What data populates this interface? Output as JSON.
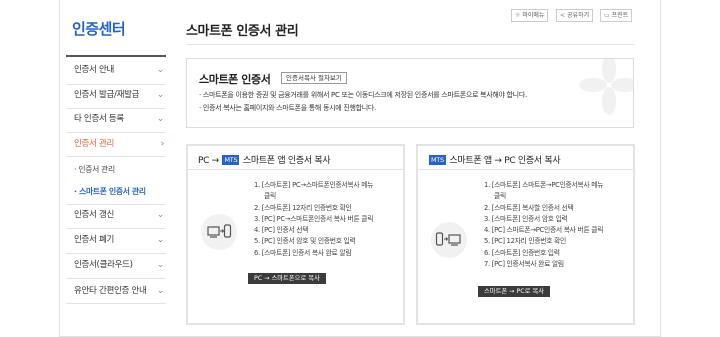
{
  "sidebar": {
    "title": "인증센터",
    "items": [
      {
        "label": "인증서 안내"
      },
      {
        "label": "인증서 발급/재발급"
      },
      {
        "label": "타 인증서 등록"
      },
      {
        "label": "인증서 관리"
      },
      {
        "label": "인증서 갱신"
      },
      {
        "label": "인증서 폐기"
      },
      {
        "label": "인증서(클라우드)"
      },
      {
        "label": "유안타 간편인증 안내"
      }
    ],
    "subitems": [
      {
        "label": "· 인증서 관리"
      },
      {
        "label": "· 스마트폰 인증서 관리"
      }
    ],
    "chevron": "›",
    "chevron_down": "⌄"
  },
  "header": {
    "title": "스마트폰 인증서 관리",
    "utils": [
      {
        "label": "마이메뉴",
        "icon": "☼"
      },
      {
        "label": "공유하기",
        "icon": "<"
      },
      {
        "label": "프린트",
        "icon": "▭"
      }
    ]
  },
  "info": {
    "heading": "스마트폰 인증서",
    "guide_button": "인증서복사 절차보기",
    "lines": [
      "· 스마트폰을 이용한 증권 및 금융거래를 위해서 PC 또는 이동디스크에 저장된 인증서를 스마트폰으로 복사해야 합니다.",
      "· 인증서 복사는 홈페이지와 스마트폰을 통해 동시에 진행합니다."
    ]
  },
  "cards": [
    {
      "head_pre": "PC →",
      "mts": "MTS",
      "head_post": "스마트폰 앱 인증서 복사",
      "icon": "pc-to-phone-icon",
      "steps": [
        [
          "1. [스마트폰] PC→스마트폰인증서복사 메뉴",
          "클릭"
        ],
        [
          "2. [스마트폰] 12자리 인증번호 확인"
        ],
        [
          "3. [PC] PC→스마트폰인증서 복사 버튼 클릭"
        ],
        [
          "4. [PC] 인증서 선택"
        ],
        [
          "5. [PC] 인증서 암호 및 인증번호 입력"
        ],
        [
          "6. [스마트폰] 인증서 복사 완료 알림"
        ]
      ],
      "button": "PC → 스마트폰으로 복사"
    },
    {
      "head_pre": "",
      "mts": "MTS",
      "head_post": "스마트폰 앱 → PC 인증서 복사",
      "icon": "phone-to-pc-icon",
      "steps": [
        [
          "1. [스마트폰] 스마트폰→PC인증서복사 메뉴",
          "클릭"
        ],
        [
          "2. [스마트폰] 복사할 인증서 선택"
        ],
        [
          "3. [스마트폰] 인증서 암호 입력"
        ],
        [
          "4. [PC] 스마트폰→PC인증서 복사 버튼 클릭"
        ],
        [
          "5. [PC] 12자리 인증번호 확인"
        ],
        [
          "6. [스마트폰] 인증번호 입력"
        ],
        [
          "7. [PC] 인증서복사 완료 알림"
        ]
      ],
      "button": "스마트폰 → PC로 복사"
    }
  ],
  "colors": {
    "accent": "#2762c6",
    "active": "#e4632f"
  }
}
